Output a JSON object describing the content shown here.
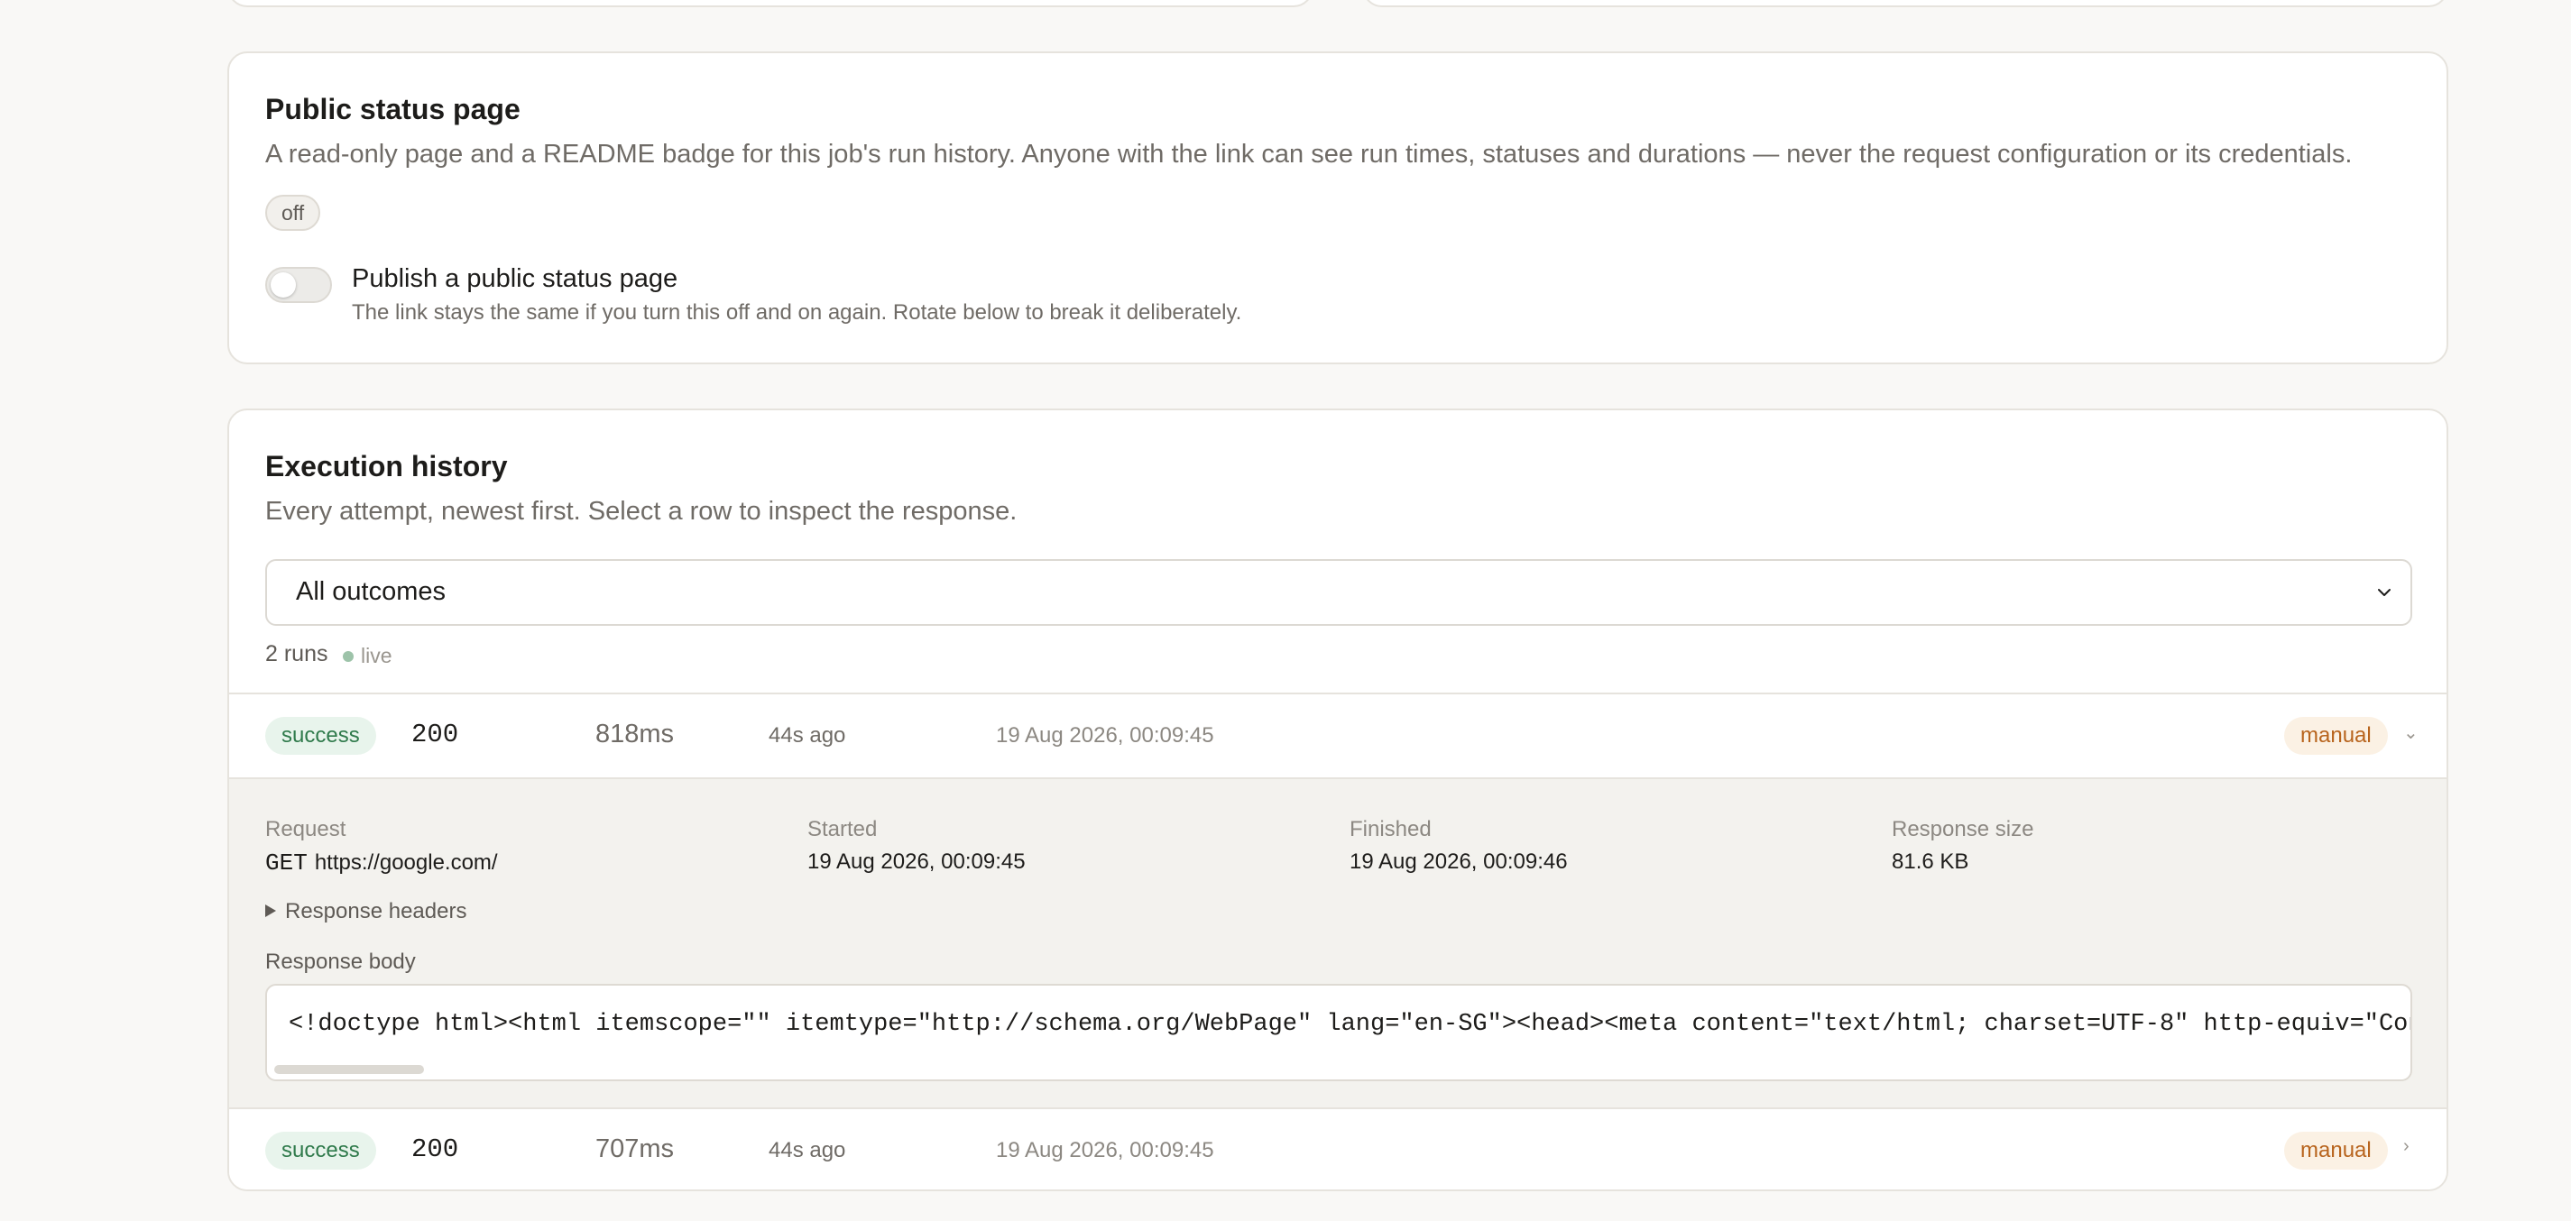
{
  "status_page": {
    "title": "Public status page",
    "description": "A read-only page and a README badge for this job's run history. Anyone with the link can see run times, statuses and durations — never the request configuration or its credentials.",
    "state_badge": "off",
    "toggle_on": false,
    "toggle_label": "Publish a public status page",
    "toggle_hint": "The link stays the same if you turn this off and on again. Rotate below to break it deliberately."
  },
  "history": {
    "title": "Execution history",
    "description": "Every attempt, newest first. Select a row to inspect the response.",
    "filter": {
      "selected": "All outcomes"
    },
    "runs_count": "2 runs",
    "live_label": "live",
    "runs": [
      {
        "status": "success",
        "code": "200",
        "duration": "818ms",
        "ago": "44s ago",
        "timestamp": "19 Aug 2026, 00:09:45",
        "trigger": "manual",
        "expanded": true
      },
      {
        "status": "success",
        "code": "200",
        "duration": "707ms",
        "ago": "44s ago",
        "timestamp": "19 Aug 2026, 00:09:45",
        "trigger": "manual",
        "expanded": false
      }
    ],
    "detail": {
      "request_label": "Request",
      "method": "GET",
      "url": "https://google.com/",
      "started_label": "Started",
      "started": "19 Aug 2026, 00:09:45",
      "finished_label": "Finished",
      "finished": "19 Aug 2026, 00:09:46",
      "size_label": "Response size",
      "size": "81.6 KB",
      "headers_label": "Response headers",
      "body_label": "Response body",
      "body": "<!doctype html><html itemscope=\"\" itemtype=\"http://schema.org/WebPage\" lang=\"en-SG\"><head><meta content=\"text/html; charset=UTF-8\" http-equiv=\"Content-Type\">"
    }
  },
  "colors": {
    "success_bg": "#e8f4ec",
    "success_text": "#2f7a4b",
    "manual_bg": "#fbf1e4",
    "manual_text": "#b8641d",
    "live_dot": "#9dc3a9"
  }
}
